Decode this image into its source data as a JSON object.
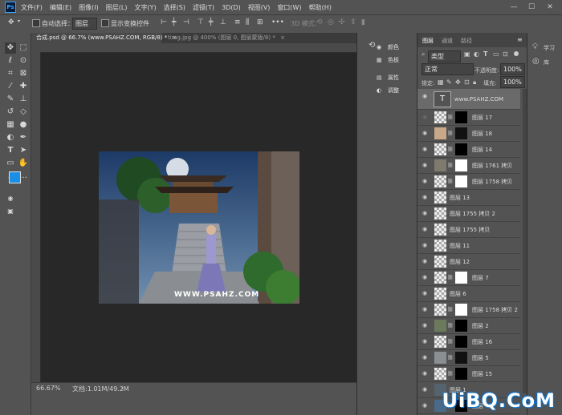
{
  "app": {
    "logo": "Ps"
  },
  "menu": [
    "文件(F)",
    "编辑(E)",
    "图像(I)",
    "图层(L)",
    "文字(Y)",
    "选择(S)",
    "滤镜(T)",
    "3D(D)",
    "视图(V)",
    "窗口(W)",
    "帮助(H)"
  ],
  "options_bar": {
    "auto_select_label": "自动选择：",
    "auto_select_value": "图层",
    "show_transform_label": "显示变换控件",
    "mode_3d_label": "3D 模式："
  },
  "tabs": [
    {
      "label": "合成.psd @ 66.7% (www.PSAHZ.COM, RGB/8) *",
      "active": true
    },
    {
      "label": "timg.jpg @ 400% (图层 0, 图层蒙版/8) *",
      "active": false
    }
  ],
  "canvas": {
    "watermark_text": "WWW.PSAHZ.COM"
  },
  "status": {
    "zoom": "66.67%",
    "doc": "文档:1.01M/49.2M"
  },
  "mid_panel": {
    "items": [
      "颜色",
      "色板",
      "属性",
      "调整"
    ]
  },
  "layers_panel": {
    "tabs": [
      "图层",
      "通道",
      "路径"
    ],
    "kind_filter": "类型",
    "blend_mode": "正常",
    "opacity_label": "不透明度:",
    "opacity_value": "100%",
    "lock_label": "锁定:",
    "fill_label": "填充:",
    "fill_value": "100%",
    "layers": [
      {
        "name": "www.PSAHZ.COM",
        "type": "text"
      },
      {
        "name": "图层 17"
      },
      {
        "name": "图层 18"
      },
      {
        "name": "图层 14"
      },
      {
        "name": "图层 1761 拷贝"
      },
      {
        "name": "图层 1758 拷贝"
      },
      {
        "name": "图层 13"
      },
      {
        "name": "图层 1755 拷贝 2"
      },
      {
        "name": "图层 1755 拷贝"
      },
      {
        "name": "图层 11"
      },
      {
        "name": "图层 12"
      },
      {
        "name": "图层 7"
      },
      {
        "name": "图层 6"
      },
      {
        "name": "图层 1758 拷贝 2"
      },
      {
        "name": "图层 2"
      },
      {
        "name": "图层 16"
      },
      {
        "name": "图层 5"
      },
      {
        "name": "图层 15"
      },
      {
        "name": "图层 1"
      },
      {
        "name": "图层 4"
      }
    ]
  },
  "right_panel": {
    "items": [
      "学习",
      "库"
    ]
  },
  "site_watermark": "UiBQ.CoM",
  "colors": {
    "accent": "#31a8ff",
    "foreground": "#1a8fe8",
    "background": "#ffffff"
  }
}
